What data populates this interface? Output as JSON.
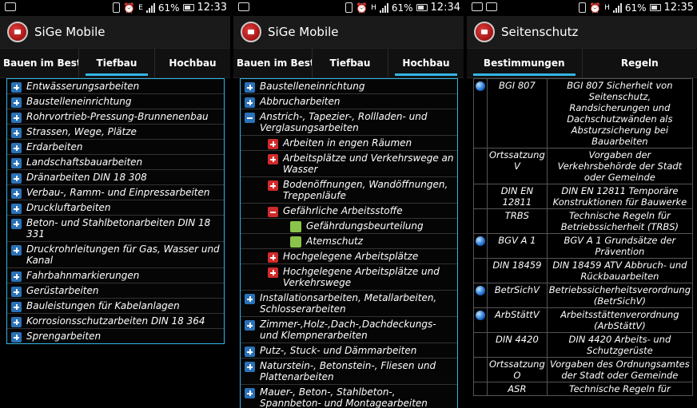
{
  "screens": [
    {
      "status": {
        "network": "E",
        "battery": "61%",
        "time": "12:33"
      },
      "title": "SiGe Mobile",
      "tabs": [
        {
          "label": "Bauen im Bestand",
          "active": false
        },
        {
          "label": "Tiefbau",
          "active": true
        },
        {
          "label": "Hochbau",
          "active": false
        }
      ],
      "items": [
        "Entwässerungsarbeiten",
        "Baustelleneinrichtung",
        "Rohrvortrieb-Pressung-Brunnenenbau",
        "Strassen, Wege, Plätze",
        "Erdarbeiten",
        "Landschaftsbauarbeiten",
        "Dränarbeiten DIN 18 308",
        "Verbau-, Ramm- und Einpressarbeiten",
        "Druckluftarbeiten",
        "Beton- und Stahlbetonarbeiten DIN 18 331",
        "Druckrohrleitungen für Gas, Wasser und Kanal",
        "Fahrbahnmarkierungen",
        "Gerüstarbeiten",
        "Bauleistungen für Kabelanlagen",
        "Korrosionsschutzarbeiten DIN 18 364",
        "Sprengarbeiten"
      ]
    },
    {
      "status": {
        "network": "H",
        "battery": "61%",
        "time": "12:34"
      },
      "title": "SiGe Mobile",
      "tabs": [
        {
          "label": "Bauen im Bestand",
          "active": false
        },
        {
          "label": "Tiefbau",
          "active": false
        },
        {
          "label": "Hochbau",
          "active": true
        }
      ],
      "items": [
        {
          "label": "Baustelleneinrichtung",
          "level": 1,
          "state": "plus"
        },
        {
          "label": "Abbrucharbeiten",
          "level": 1,
          "state": "plus"
        },
        {
          "label": "Anstrich-, Tapezier-, Rollladen- und Verglasungsarbeiten",
          "level": 1,
          "state": "minus"
        },
        {
          "label": "Arbeiten in engen Räumen",
          "level": 2,
          "state": "plus"
        },
        {
          "label": "Arbeitsplätze und Verkehrswege an Wasser",
          "level": 2,
          "state": "plus"
        },
        {
          "label": "Bodenöffnungen, Wandöffnungen, Treppenläufe",
          "level": 2,
          "state": "plus"
        },
        {
          "label": "Gefährliche Arbeitsstoffe",
          "level": 2,
          "state": "minus"
        },
        {
          "label": "Gefährdungsbeurteilung",
          "level": 3,
          "state": "leaf"
        },
        {
          "label": "Atemschutz",
          "level": 3,
          "state": "leaf"
        },
        {
          "label": "Hochgelegene Arbeitsplätze",
          "level": 2,
          "state": "plus"
        },
        {
          "label": "Hochgelegene Arbeitsplätze und Verkehrswege",
          "level": 2,
          "state": "plus"
        },
        {
          "label": "Installationsarbeiten, Metallarbeiten, Schlosserarbeiten",
          "level": 1,
          "state": "plus"
        },
        {
          "label": "Zimmer-,Holz-,Dach-,Dachdeckungs- und Klempnerarbeiten",
          "level": 1,
          "state": "plus"
        },
        {
          "label": "Putz-, Stuck- und Dämmarbeiten",
          "level": 1,
          "state": "plus"
        },
        {
          "label": "Naturstein-, Betonstein-, Fliesen und Plattenarbeiten",
          "level": 1,
          "state": "plus"
        },
        {
          "label": "Mauer-, Beton-, Stahlbeton-, Spannbeton- und Montagearbeiten",
          "level": 1,
          "state": "plus"
        }
      ]
    },
    {
      "status": {
        "network": "H",
        "battery": "61%",
        "time": "12:35"
      },
      "title": "Seitenschutz",
      "tabs": [
        {
          "label": "Bestimmungen",
          "active": true
        },
        {
          "label": "Regeln",
          "active": false
        }
      ],
      "rows": [
        {
          "globe": true,
          "code": "BGI 807",
          "desc": "BGI 807 Sicherheit von Seitenschutz, Randsicherungen und Dachschutzwänden als Absturzsicherung bei Bauarbeiten"
        },
        {
          "globe": false,
          "code": "Ortssatzung V",
          "desc": "Vorgaben der Verkehrsbehörde der Stadt oder Gemeinde"
        },
        {
          "globe": false,
          "code": "DIN EN 12811",
          "desc": "DIN EN 12811 Temporäre Konstruktionen für Bauwerke"
        },
        {
          "globe": false,
          "code": "TRBS",
          "desc": "Technische Regeln für Betriebssicherheit (TRBS)"
        },
        {
          "globe": true,
          "code": "BGV A 1",
          "desc": "BGV A 1 Grundsätze der Prävention"
        },
        {
          "globe": false,
          "code": "DIN 18459",
          "desc": "DIN 18459 ATV Abbruch- und Rückbauarbeiten"
        },
        {
          "globe": true,
          "code": "BetrSichV",
          "desc": "Betriebssicherheitsverordnung (BetrSichV)"
        },
        {
          "globe": true,
          "code": "ArbStättV",
          "desc": "Arbeitsstättenverordnung (ArbStättV)"
        },
        {
          "globe": false,
          "code": "DIN 4420",
          "desc": "DIN 4420 Arbeits- und Schutzgerüste"
        },
        {
          "globe": false,
          "code": "Ortssatzung O",
          "desc": "Vorgaben des Ordnungsamtes der Stadt oder Gemeinde"
        },
        {
          "globe": false,
          "code": "ASR",
          "desc": "Technische Regeln für"
        }
      ]
    }
  ]
}
